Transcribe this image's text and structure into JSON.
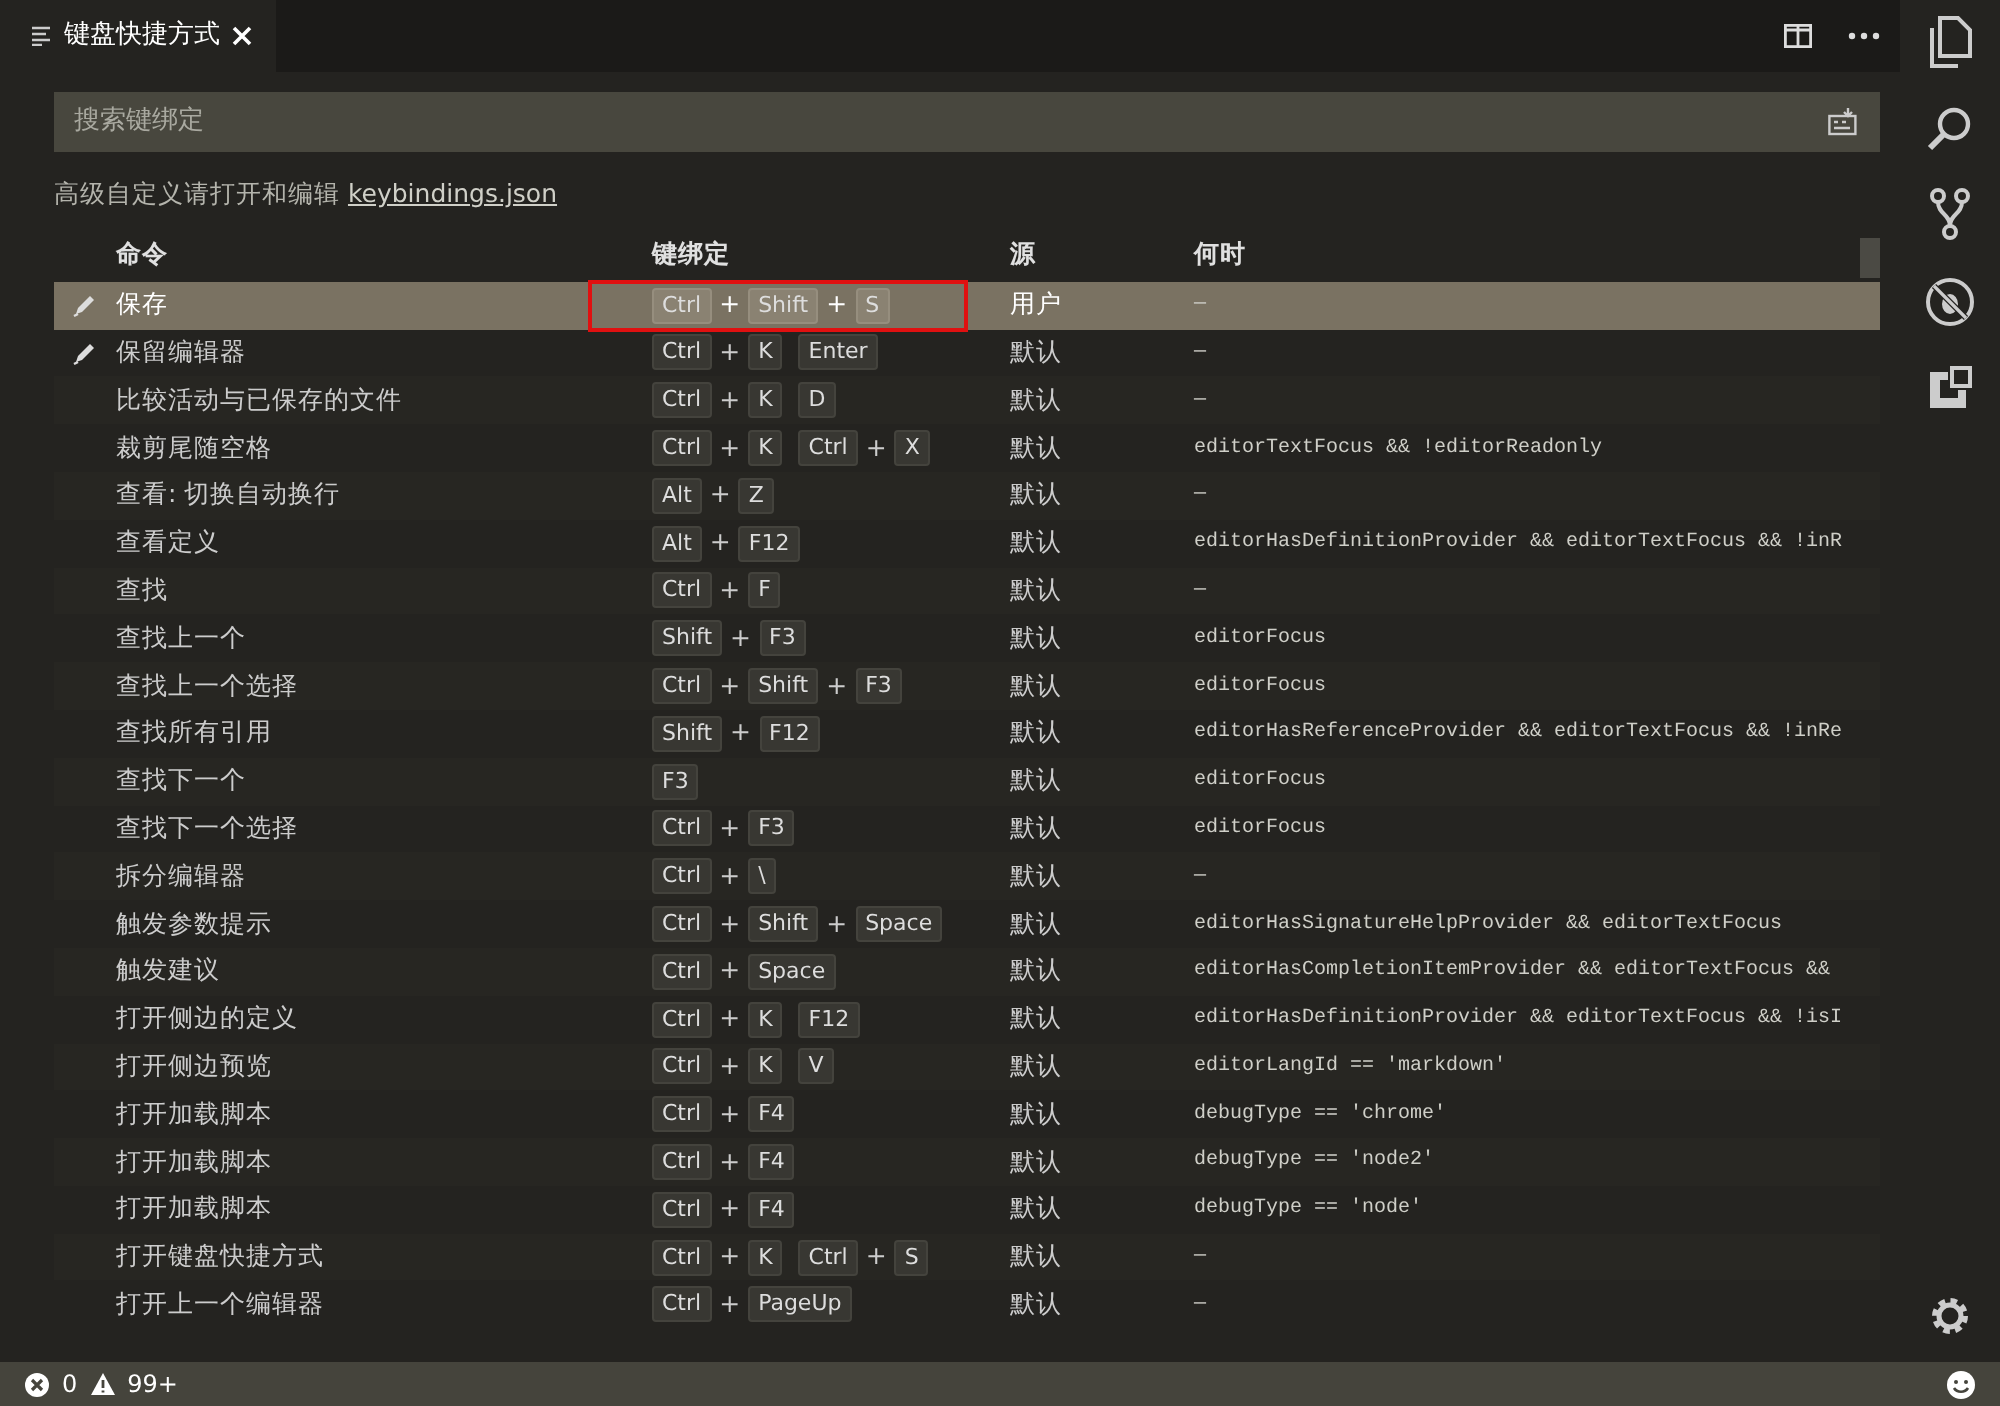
{
  "tab": {
    "title": "键盘快捷方式"
  },
  "search": {
    "placeholder": "搜索键绑定"
  },
  "hint": {
    "text": "高级自定义请打开和编辑",
    "link": "keybindings.json"
  },
  "key_joiner": "+",
  "columns": [
    "命令",
    "键绑定",
    "源",
    "何时"
  ],
  "rows": [
    {
      "command": "保存",
      "chords": [
        [
          "Ctrl",
          "Shift",
          "S"
        ]
      ],
      "source": "用户",
      "when": "—",
      "selected": true,
      "outlined": true,
      "edited": true
    },
    {
      "command": "保留编辑器",
      "chords": [
        [
          "Ctrl",
          "K"
        ],
        [
          "Enter"
        ]
      ],
      "source": "默认",
      "when": "—",
      "selected": false,
      "outlined": false,
      "edited": true
    },
    {
      "command": "比较活动与已保存的文件",
      "chords": [
        [
          "Ctrl",
          "K"
        ],
        [
          "D"
        ]
      ],
      "source": "默认",
      "when": "—",
      "selected": false,
      "outlined": false,
      "edited": false
    },
    {
      "command": "裁剪尾随空格",
      "chords": [
        [
          "Ctrl",
          "K"
        ],
        [
          "Ctrl",
          "X"
        ]
      ],
      "source": "默认",
      "when": "editorTextFocus && !editorReadonly",
      "selected": false,
      "outlined": false,
      "edited": false
    },
    {
      "command": "查看: 切换自动换行",
      "chords": [
        [
          "Alt",
          "Z"
        ]
      ],
      "source": "默认",
      "when": "—",
      "selected": false,
      "outlined": false,
      "edited": false
    },
    {
      "command": "查看定义",
      "chords": [
        [
          "Alt",
          "F12"
        ]
      ],
      "source": "默认",
      "when": "editorHasDefinitionProvider && editorTextFocus && !inR",
      "selected": false,
      "outlined": false,
      "edited": false
    },
    {
      "command": "查找",
      "chords": [
        [
          "Ctrl",
          "F"
        ]
      ],
      "source": "默认",
      "when": "—",
      "selected": false,
      "outlined": false,
      "edited": false
    },
    {
      "command": "查找上一个",
      "chords": [
        [
          "Shift",
          "F3"
        ]
      ],
      "source": "默认",
      "when": "editorFocus",
      "selected": false,
      "outlined": false,
      "edited": false
    },
    {
      "command": "查找上一个选择",
      "chords": [
        [
          "Ctrl",
          "Shift",
          "F3"
        ]
      ],
      "source": "默认",
      "when": "editorFocus",
      "selected": false,
      "outlined": false,
      "edited": false
    },
    {
      "command": "查找所有引用",
      "chords": [
        [
          "Shift",
          "F12"
        ]
      ],
      "source": "默认",
      "when": "editorHasReferenceProvider && editorTextFocus && !inRe",
      "selected": false,
      "outlined": false,
      "edited": false
    },
    {
      "command": "查找下一个",
      "chords": [
        [
          "F3"
        ]
      ],
      "source": "默认",
      "when": "editorFocus",
      "selected": false,
      "outlined": false,
      "edited": false
    },
    {
      "command": "查找下一个选择",
      "chords": [
        [
          "Ctrl",
          "F3"
        ]
      ],
      "source": "默认",
      "when": "editorFocus",
      "selected": false,
      "outlined": false,
      "edited": false
    },
    {
      "command": "拆分编辑器",
      "chords": [
        [
          "Ctrl",
          "\\"
        ]
      ],
      "source": "默认",
      "when": "—",
      "selected": false,
      "outlined": false,
      "edited": false
    },
    {
      "command": "触发参数提示",
      "chords": [
        [
          "Ctrl",
          "Shift",
          "Space"
        ]
      ],
      "source": "默认",
      "when": "editorHasSignatureHelpProvider && editorTextFocus",
      "selected": false,
      "outlined": false,
      "edited": false
    },
    {
      "command": "触发建议",
      "chords": [
        [
          "Ctrl",
          "Space"
        ]
      ],
      "source": "默认",
      "when": "editorHasCompletionItemProvider && editorTextFocus &&",
      "selected": false,
      "outlined": false,
      "edited": false
    },
    {
      "command": "打开侧边的定义",
      "chords": [
        [
          "Ctrl",
          "K"
        ],
        [
          "F12"
        ]
      ],
      "source": "默认",
      "when": "editorHasDefinitionProvider && editorTextFocus && !isI",
      "selected": false,
      "outlined": false,
      "edited": false
    },
    {
      "command": "打开侧边预览",
      "chords": [
        [
          "Ctrl",
          "K"
        ],
        [
          "V"
        ]
      ],
      "source": "默认",
      "when": "editorLangId == 'markdown'",
      "selected": false,
      "outlined": false,
      "edited": false
    },
    {
      "command": "打开加载脚本",
      "chords": [
        [
          "Ctrl",
          "F4"
        ]
      ],
      "source": "默认",
      "when": "debugType == 'chrome'",
      "selected": false,
      "outlined": false,
      "edited": false
    },
    {
      "command": "打开加载脚本",
      "chords": [
        [
          "Ctrl",
          "F4"
        ]
      ],
      "source": "默认",
      "when": "debugType == 'node2'",
      "selected": false,
      "outlined": false,
      "edited": false
    },
    {
      "command": "打开加载脚本",
      "chords": [
        [
          "Ctrl",
          "F4"
        ]
      ],
      "source": "默认",
      "when": "debugType == 'node'",
      "selected": false,
      "outlined": false,
      "edited": false
    },
    {
      "command": "打开键盘快捷方式",
      "chords": [
        [
          "Ctrl",
          "K"
        ],
        [
          "Ctrl",
          "S"
        ]
      ],
      "source": "默认",
      "when": "—",
      "selected": false,
      "outlined": false,
      "edited": false
    },
    {
      "command": "打开上一个编辑器",
      "chords": [
        [
          "Ctrl",
          "PageUp"
        ]
      ],
      "source": "默认",
      "when": "—",
      "selected": false,
      "outlined": false,
      "edited": false
    }
  ],
  "status_bar": {
    "errors": "0",
    "warnings": "99+"
  }
}
